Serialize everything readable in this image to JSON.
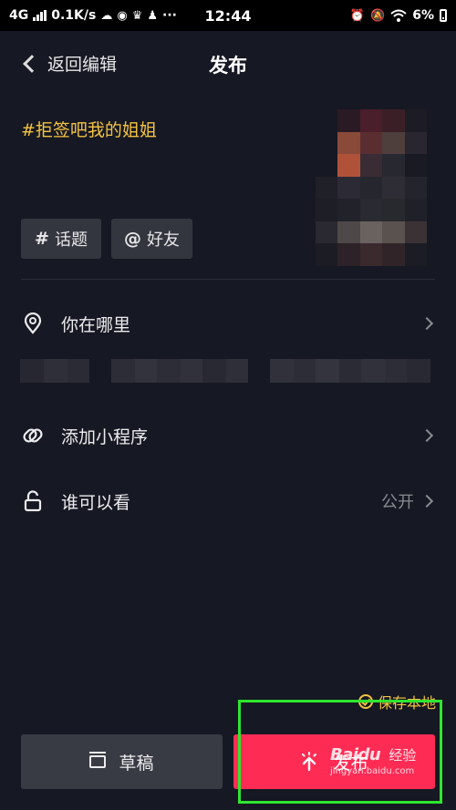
{
  "status_bar": {
    "network": "4G",
    "speed": "0.1K/s",
    "dots": "···",
    "time": "12:44",
    "battery": "6%",
    "icons": [
      "signal-icon",
      "cloud-icon",
      "wechat-icon",
      "crown-icon",
      "qq-icon",
      "alarm-icon",
      "mute-icon",
      "wifi-icon",
      "battery-icon"
    ]
  },
  "header": {
    "back_label": "返回编辑",
    "title": "发布"
  },
  "caption": "#拒签吧我的姐姐",
  "tags": {
    "topic_symbol": "#",
    "topic_label": "话题",
    "friend_symbol": "@",
    "friend_label": "好友"
  },
  "options": {
    "location_label": "你在哪里",
    "miniapp_label": "添加小程序",
    "privacy_label": "谁可以看",
    "privacy_value": "公开"
  },
  "save_local_label": "保存本地",
  "bottom": {
    "draft_label": "草稿",
    "publish_label": "发布"
  },
  "watermark": {
    "brand": "Baidu",
    "sub": "经验",
    "url": "jingyan.baidu.com"
  },
  "colors": {
    "background": "#161823",
    "accent_yellow": "#f5c342",
    "publish_red": "#fe2c55",
    "highlight_green": "#2ee62e"
  }
}
